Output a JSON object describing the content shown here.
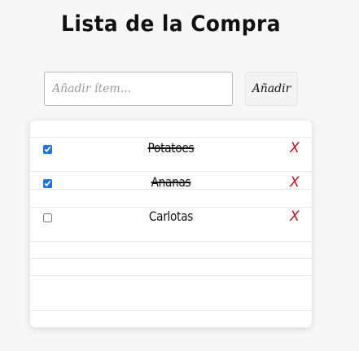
{
  "header": {
    "title": "Lista de la Compra"
  },
  "add_form": {
    "placeholder": "Añadir ítem...",
    "button_label": "Añadir"
  },
  "items": [
    {
      "label": "Potatoes",
      "checked": true,
      "delete_label": "X"
    },
    {
      "label": "Ananas",
      "checked": true,
      "delete_label": "X"
    },
    {
      "label": "Carlotas",
      "checked": false,
      "delete_label": "X"
    }
  ],
  "colors": {
    "background": "#f7f7f7",
    "delete": "#c0121f",
    "checkbox_accent": "#1a73e8"
  }
}
